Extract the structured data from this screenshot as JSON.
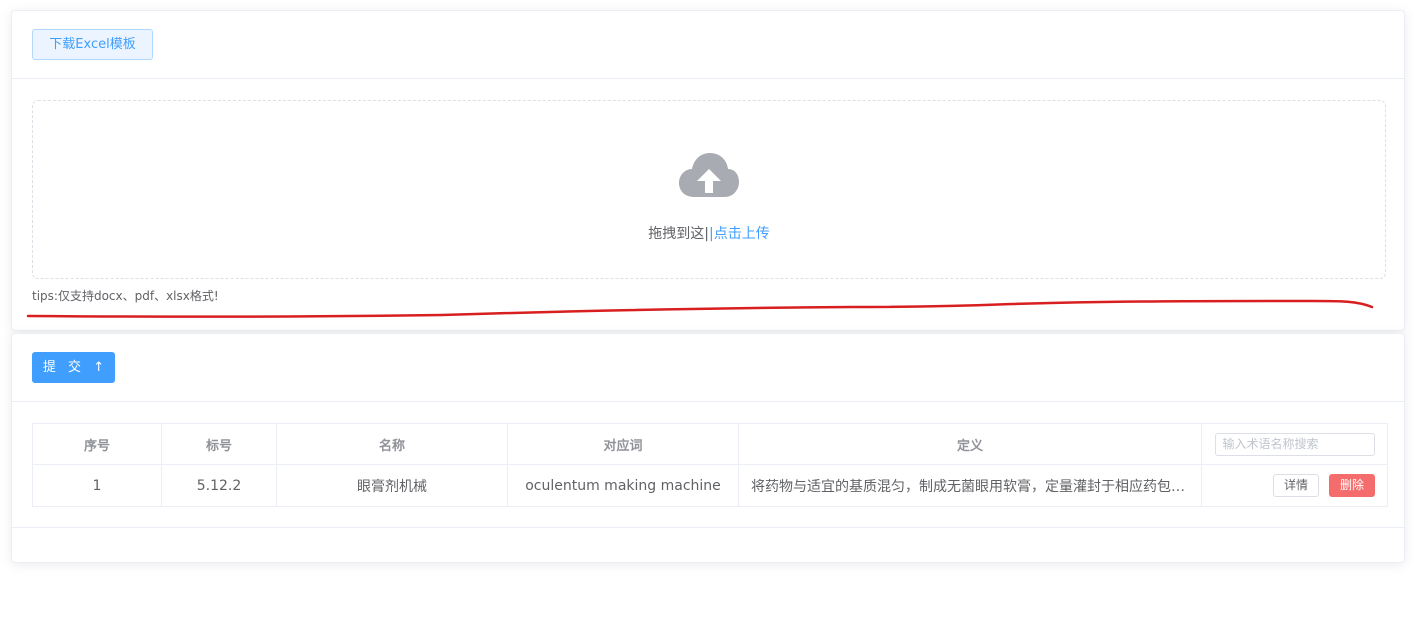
{
  "header": {
    "download_label": "下载Excel模板"
  },
  "upload": {
    "icon": "cloud-upload-icon",
    "text": "拖拽到这|",
    "link_text": "|点击上传",
    "tips": "tips:仅支持docx、pdf、xlsx格式!"
  },
  "submit": {
    "label": "提 交",
    "icon": "upload-arrow-icon"
  },
  "table": {
    "columns": [
      "序号",
      "标号",
      "名称",
      "对应词",
      "定义"
    ],
    "search_placeholder": "输入术语名称搜索",
    "rows": [
      {
        "index": "1",
        "code": "5.12.2",
        "name": "眼膏剂机械",
        "term": "oculentum making machine",
        "definition": "将药物与适宜的基质混匀，制成无菌眼用软膏，定量灌封于相应药包材中的机械。",
        "detail_label": "详情",
        "delete_label": "删除"
      }
    ]
  },
  "colors": {
    "primary": "#409eff",
    "danger": "#f56c6c",
    "annotation": "#d81e1e"
  }
}
